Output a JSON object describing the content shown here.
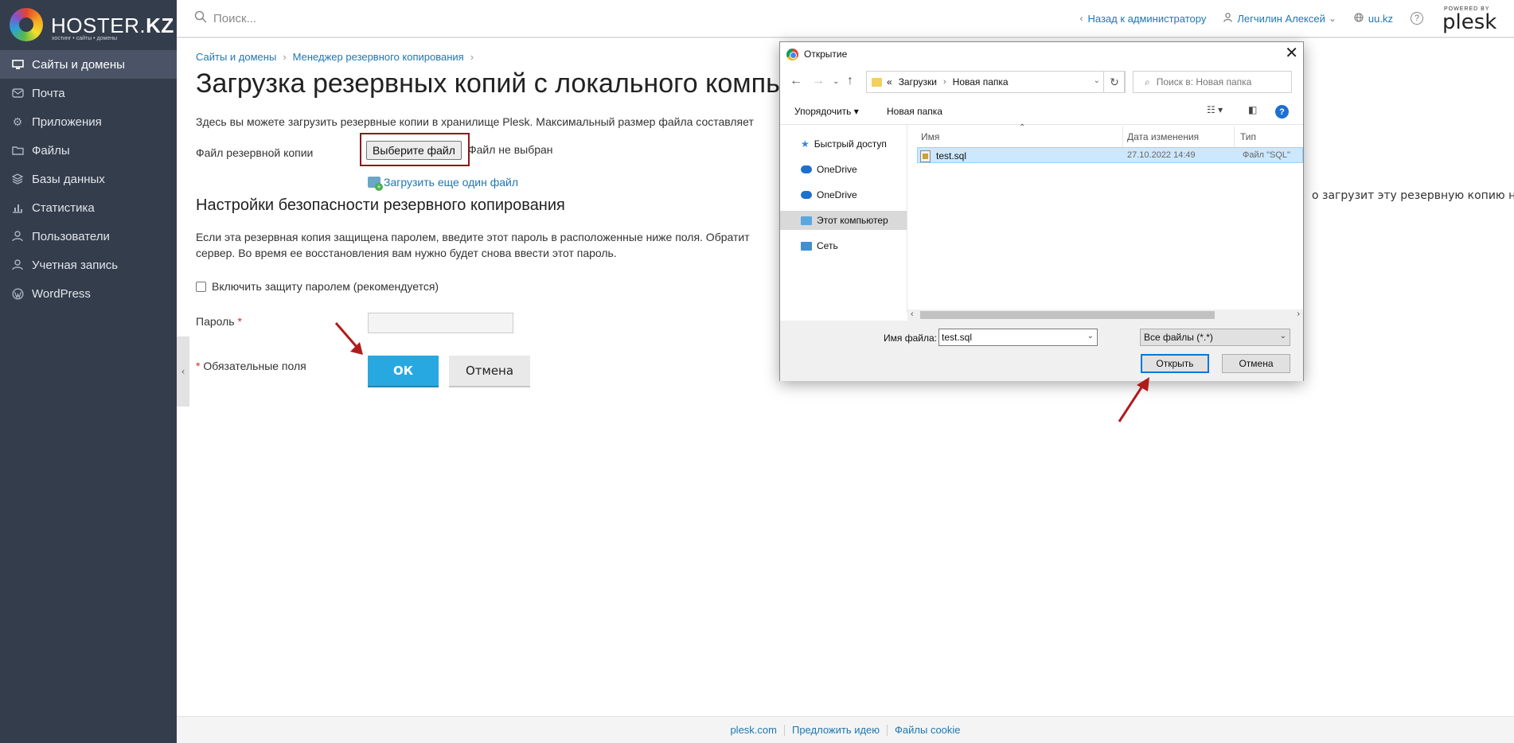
{
  "brand": {
    "logo_text_plain": "HOSTER.",
    "logo_text_bold": "KZ",
    "logo_sub": "хостинг • сайты • домены"
  },
  "sidebar": {
    "items": [
      {
        "label": "Сайты и домены",
        "icon": "monitor-icon",
        "active": true
      },
      {
        "label": "Почта",
        "icon": "mail-icon"
      },
      {
        "label": "Приложения",
        "icon": "gear-icon"
      },
      {
        "label": "Файлы",
        "icon": "folder-icon"
      },
      {
        "label": "Базы данных",
        "icon": "database-icon"
      },
      {
        "label": "Статистика",
        "icon": "bar-chart-icon"
      },
      {
        "label": "Пользователи",
        "icon": "user-icon"
      },
      {
        "label": "Учетная запись",
        "icon": "account-icon"
      },
      {
        "label": "WordPress",
        "icon": "wordpress-icon"
      }
    ]
  },
  "topbar": {
    "search_placeholder": "Поиск...",
    "back_admin": "Назад к администратору",
    "user": "Легчилин Алексей",
    "domain": "uu.kz",
    "powered_by": "POWERED BY",
    "plesk": "plesk"
  },
  "breadcrumb": [
    "Сайты и домены",
    "Менеджер резервного копирования"
  ],
  "page": {
    "title": "Загрузка резервных копий с локального компь",
    "intro": "Здесь вы можете загрузить резервные копии в хранилище Plesk. Максимальный размер файла составляет",
    "file_label": "Файл резервной копии",
    "choose_file": "Выберите файл",
    "no_file": "Файл не выбран",
    "add_file": "Загрузить еще один файл",
    "security_heading": "Настройки безопасности резервного копирования",
    "security_text_1": "Если эта резервная копия защищена паролем, введите этот пароль в расположенные ниже поля. Обратит",
    "security_text_2": "сервер. Во время ее восстановления вам нужно будет снова ввести этот пароль.",
    "security_text_right": "о загрузит эту резервную копию на",
    "checkbox": "Включить защиту паролем (рекомендуется)",
    "password_label": "Пароль",
    "required_mark": "*",
    "required_note": "Обязательные поля",
    "ok": "ОК",
    "cancel": "Отмена"
  },
  "footer": {
    "links": [
      "plesk.com",
      "Предложить идею",
      "Файлы cookie"
    ]
  },
  "dialog": {
    "title": "Открытие",
    "path_prefix": "«",
    "path": [
      "Загрузки",
      "Новая папка"
    ],
    "search_placeholder": "Поиск в: Новая папка",
    "organize": "Упорядочить",
    "new_folder": "Новая папка",
    "nav": [
      "Быстрый доступ",
      "OneDrive",
      "OneDrive",
      "Этот компьютер",
      "Сеть"
    ],
    "columns": {
      "name": "Имя",
      "modified": "Дата изменения",
      "type": "Тип"
    },
    "files": [
      {
        "name": "test.sql",
        "modified": "27.10.2022 14:49",
        "type": "Файл \"SQL\""
      }
    ],
    "filename_label": "Имя файла:",
    "filename_value": "test.sql",
    "filetype": "Все файлы (*.*)",
    "open": "Открыть",
    "cancel": "Отмена"
  },
  "colors": {
    "sidebar": "#343d4c",
    "accent": "#28a8e0",
    "link": "#1e77b3",
    "annotation_arrow": "#b01c1c"
  }
}
